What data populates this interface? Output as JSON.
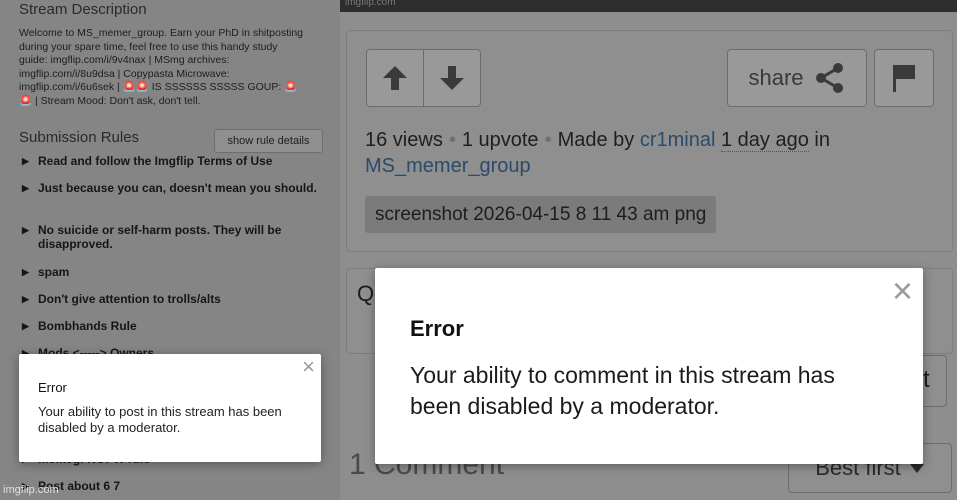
{
  "stream": {
    "description_heading": "Stream Description",
    "description_lines": [
      "Welcome to MS_memer_group. Earn your PhD in shitposting",
      "during your spare time, feel free to use this handy study",
      "guide: imgflip.com/i/9v4nax | MSmg archives:",
      "imgflip.com/i/8u9dsa | Copypasta Microwave:",
      "imgflip.com/i/6u6sek | 🚨🚨 IS SSSSSS SSSSS GOUP: 🚨",
      "🚨 | Stream Mood: Don't ask, don't tell."
    ],
    "rules_heading": "Submission Rules",
    "rules_button": "show rule details",
    "rules": [
      "Read and follow the Imgflip Terms of Use",
      "Just because you can, doesn't mean you should.",
      "No suicide or self-harm posts. They will be disapproved.",
      "spam",
      "Don't give attention to trolls/alts",
      "Bombhands Rule",
      "Mods <-----> Owners",
      "memegf NOPW rule",
      "Post about 6 7"
    ]
  },
  "image": {
    "watermark": "imgflip.com"
  },
  "post": {
    "share_label": "share",
    "views": "16 views",
    "upvotes": "1 upvote",
    "made_by_prefix": "Made by",
    "author": "cr1minal",
    "time": "1 day ago",
    "in_word": "in",
    "stream_link": "MS_memer_group",
    "tag": "screenshot 2026-04-15 8 11 43 am png"
  },
  "comment_box": {
    "partial_placeholder": "Q",
    "post_button_fragment": "t"
  },
  "comments": {
    "count_label": "1 Comment",
    "sort_label": "Best first"
  },
  "modal_small": {
    "title": "Error",
    "message": "Your ability to post in this stream has been disabled by a moderator.",
    "close_glyph": "×"
  },
  "modal_big": {
    "title": "Error",
    "message": "Your ability to comment in this stream has been disabled by a moderator.",
    "close_glyph": "×"
  },
  "footer": {
    "watermark": "imgflip.com"
  },
  "colors": {
    "overlay": "#8a8a8a",
    "link": "#2c4a6a",
    "modal_bg": "#ffffff"
  }
}
